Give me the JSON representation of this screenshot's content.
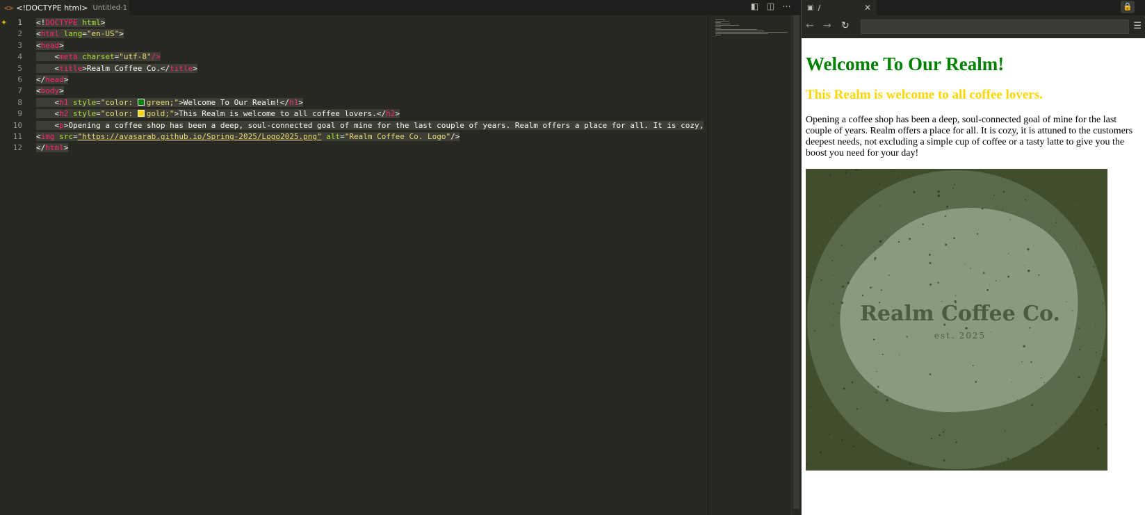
{
  "editor": {
    "tab": {
      "icon": "html-icon",
      "title": "<!DOCTYPE html>",
      "subtitle": "Untitled-1"
    },
    "actions": [
      "open-preview-icon",
      "split-editor-icon",
      "more-icon"
    ],
    "line_numbers": [
      "1",
      "2",
      "3",
      "4",
      "5",
      "6",
      "7",
      "8",
      "9",
      "10",
      "11",
      "12"
    ],
    "code": {
      "l1": [
        "<!",
        "DOCTYPE",
        " ",
        "html",
        ">"
      ],
      "l2": [
        "<",
        "html",
        " ",
        "lang",
        "=",
        "\"en-US\"",
        ">"
      ],
      "l3": [
        "<",
        "head",
        ">"
      ],
      "l4": [
        "<",
        "meta",
        " ",
        "charset",
        "=",
        "\"utf-8\"",
        "/>"
      ],
      "l5": [
        "<",
        "title",
        ">",
        "Realm Coffee Co.",
        "</",
        "title",
        ">"
      ],
      "l6": [
        "</",
        "head",
        ">"
      ],
      "l7": [
        "<",
        "body",
        ">"
      ],
      "l8": [
        "<",
        "h1",
        " ",
        "style",
        "=",
        "\"color: ",
        "green;\"",
        ">",
        "Welcome To Our Realm!",
        "</",
        "h1",
        ">"
      ],
      "l9": [
        "<",
        "h2",
        " ",
        "style",
        "=",
        "\"color: ",
        "gold;\"",
        ">",
        "This Realm is welcome to all coffee lovers.",
        "</",
        "h2",
        ">"
      ],
      "l10": [
        "<",
        "p",
        ">",
        "Opening a coffee shop has been a deep, soul-connected goal of mine for the last couple of years. Realm offers a place for all. It is cozy,"
      ],
      "l11": [
        "<",
        "img",
        " ",
        "src",
        "=",
        "\"https://avasarab.github.io/Spring-2025/Logo2025.png\"",
        " ",
        "alt",
        "=",
        "\"Realm Coffee Co. Logo\"",
        "/>"
      ],
      "l12": [
        "</",
        "html",
        ">"
      ]
    }
  },
  "preview": {
    "tab_label": "/",
    "url": "",
    "heading": "Welcome To Our Realm!",
    "subheading": "This Realm is welcome to all coffee lovers.",
    "paragraph": "Opening a coffee shop has been a deep, soul-connected goal of mine for the last couple of years. Realm offers a place for all. It is cozy, it is attuned to the customers deepest needs, not excluding a simple cup of coffee or a tasty latte to give you the boost you need for your day!",
    "logo": {
      "name": "Realm Coffee Co.",
      "est": "est. 2025"
    },
    "colors": {
      "heading": "#008000",
      "subheading": "#ffd700",
      "logo_outer": "#3f4f2e",
      "logo_mid": "#5a6a4c",
      "logo_inner": "#8a9a7e",
      "logo_text": "#4c5c40"
    }
  }
}
